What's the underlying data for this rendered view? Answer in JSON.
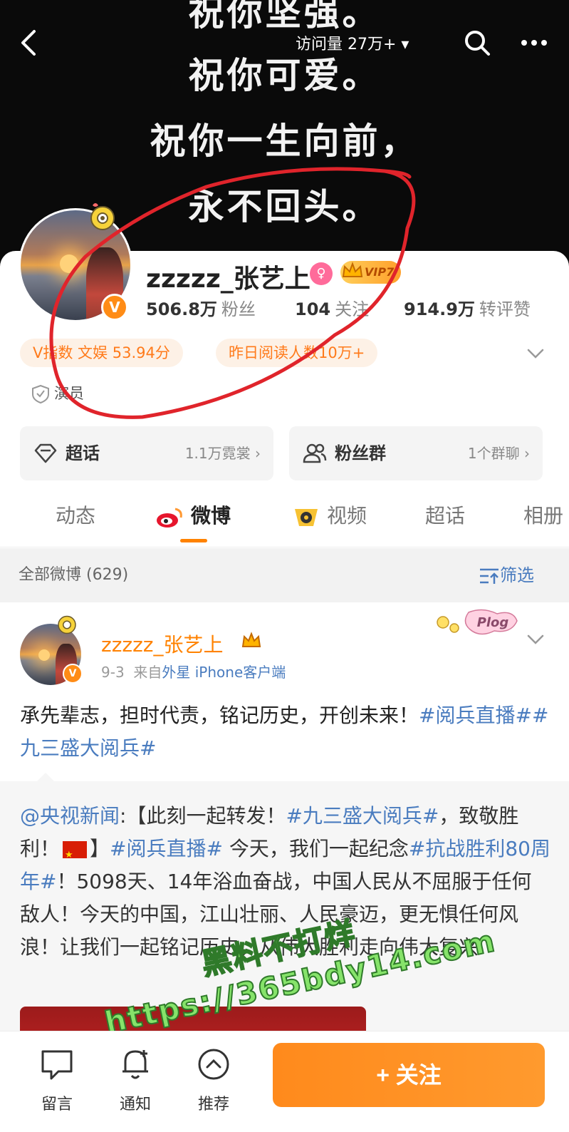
{
  "banner": {
    "lines": [
      "祝你坚强。",
      "祝你可爱。",
      "祝你一生向前，",
      "永不回头。"
    ]
  },
  "topbar": {
    "visits": "访问量 27万+ ▾"
  },
  "profile": {
    "username": "zzzzz_张艺上",
    "vip_label": "VIP7",
    "v_badge": "V",
    "stats": [
      {
        "num": "506.8万",
        "label": "粉丝"
      },
      {
        "num": "104",
        "label": "关注"
      },
      {
        "num": "914.9万",
        "label": "转评赞"
      }
    ],
    "pills": [
      "V指数 文娱 53.94分",
      "昨日阅读人数10万+"
    ],
    "role": "演员"
  },
  "tiles": [
    {
      "label": "超话",
      "meta": "1.1万霓裳 ›"
    },
    {
      "label": "粉丝群",
      "meta": "1个群聊 ›"
    }
  ],
  "tabs": [
    "动态",
    "微博",
    "视频",
    "超话",
    "相册"
  ],
  "filter": {
    "label": "全部微博 (629)",
    "button": "筛选"
  },
  "post": {
    "author": "zzzzz_张艺上",
    "date": "9-3",
    "source_prefix": "来自",
    "source": "外星 iPhone客户端",
    "text_plain": "承先辈志，担时代责，铭记历史，开创未来！",
    "text_tag1": "#阅兵直播#",
    "text_tag2": "#九三盛大阅兵#",
    "repost": {
      "mention": "@央视新闻",
      "part1": ":【此刻一起转发！",
      "tag1": "#九三盛大阅兵#",
      "part2": "，致敬胜利！",
      "part3": "】",
      "tag2": "#阅兵直播#",
      "part4": " 今天，我们一起纪念",
      "tag3": "#抗战胜利80周年#",
      "part5": "！5098天、14年浴血奋战，中国人民从不屈服于任何敌人！今天的中国，江山壮丽、人民豪迈，更无惧任何风浪！让我们一起铭记历史，从伟大胜利走向伟大复兴"
    }
  },
  "watermark": {
    "line1": "黑料不打烊",
    "line2": "https://365bdy14.com"
  },
  "bottom": {
    "items": [
      "留言",
      "通知",
      "推荐"
    ],
    "follow": "+ 关注"
  },
  "colors": {
    "accent": "#ff8200",
    "link": "#4a7cbf",
    "annotation": "#e0242b"
  }
}
